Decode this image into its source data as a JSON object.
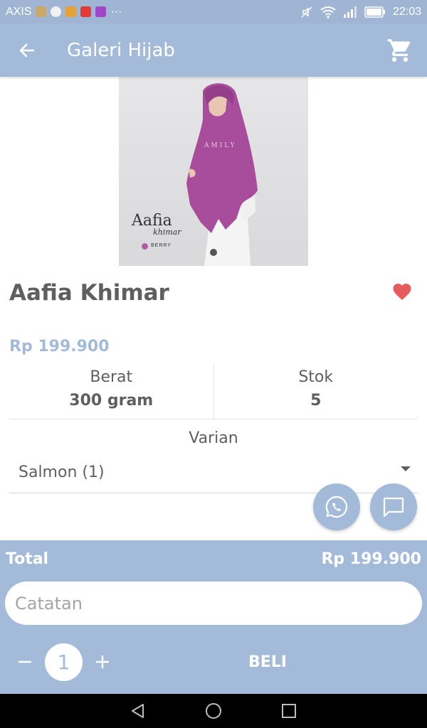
{
  "status_bar": {
    "carrier": "AXIS",
    "more": "···",
    "time": "22:03"
  },
  "app_bar": {
    "title": "Galeri Hijab"
  },
  "product_image": {
    "brand_text": "Aafia",
    "brand_sub": "khimar",
    "color_label": "BERRY",
    "logo_text": "AMILY"
  },
  "product": {
    "name": "Aafia Khimar",
    "price": "Rp 199.900",
    "weight_label": "Berat",
    "weight_value": "300 gram",
    "stock_label": "Stok",
    "stock_value": "5",
    "variant_label": "Varian",
    "variant_selected": "Salmon (1)"
  },
  "checkout": {
    "total_label": "Total",
    "total_value": "Rp 199.900",
    "notes_placeholder": "Catatan",
    "quantity": "1",
    "buy_label": "BELI"
  },
  "colors": {
    "primary": "#a3bbd8",
    "favorite": "#e65c5c",
    "text": "#5f5f5f"
  },
  "icons": {
    "back": "arrow-left-icon",
    "cart": "cart-icon",
    "favorite": "heart-icon",
    "whatsapp": "whatsapp-icon",
    "chat": "chat-icon"
  }
}
